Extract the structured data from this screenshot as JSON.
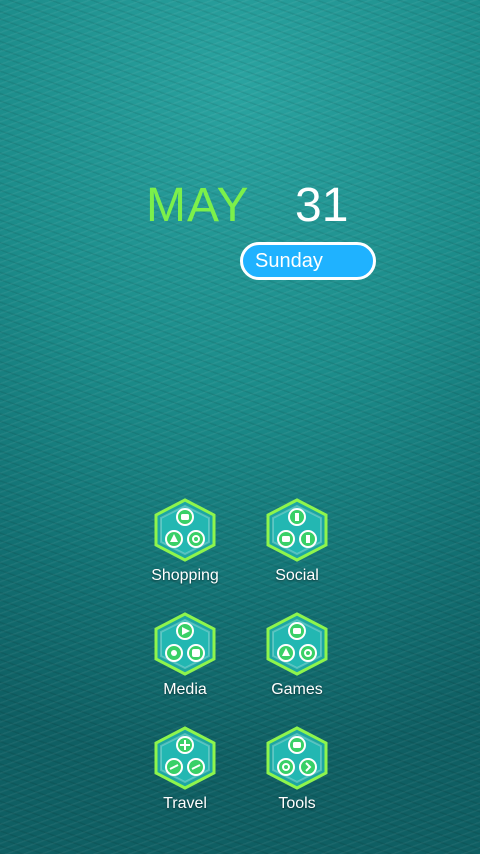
{
  "lockscreen": {
    "month": "MAY",
    "day": "31",
    "weekday": "Sunday",
    "colors": {
      "month": "#7cf04a",
      "day": "#ffffff",
      "weekday_pill": "#1fb2ff"
    }
  },
  "folders": [
    {
      "label": "Shopping",
      "icon": "shopping-folder-icon"
    },
    {
      "label": "Social",
      "icon": "social-folder-icon"
    },
    {
      "label": "Media",
      "icon": "media-folder-icon"
    },
    {
      "label": "Games",
      "icon": "games-folder-icon"
    },
    {
      "label": "Travel",
      "icon": "travel-folder-icon"
    },
    {
      "label": "Tools",
      "icon": "tools-folder-icon"
    }
  ]
}
